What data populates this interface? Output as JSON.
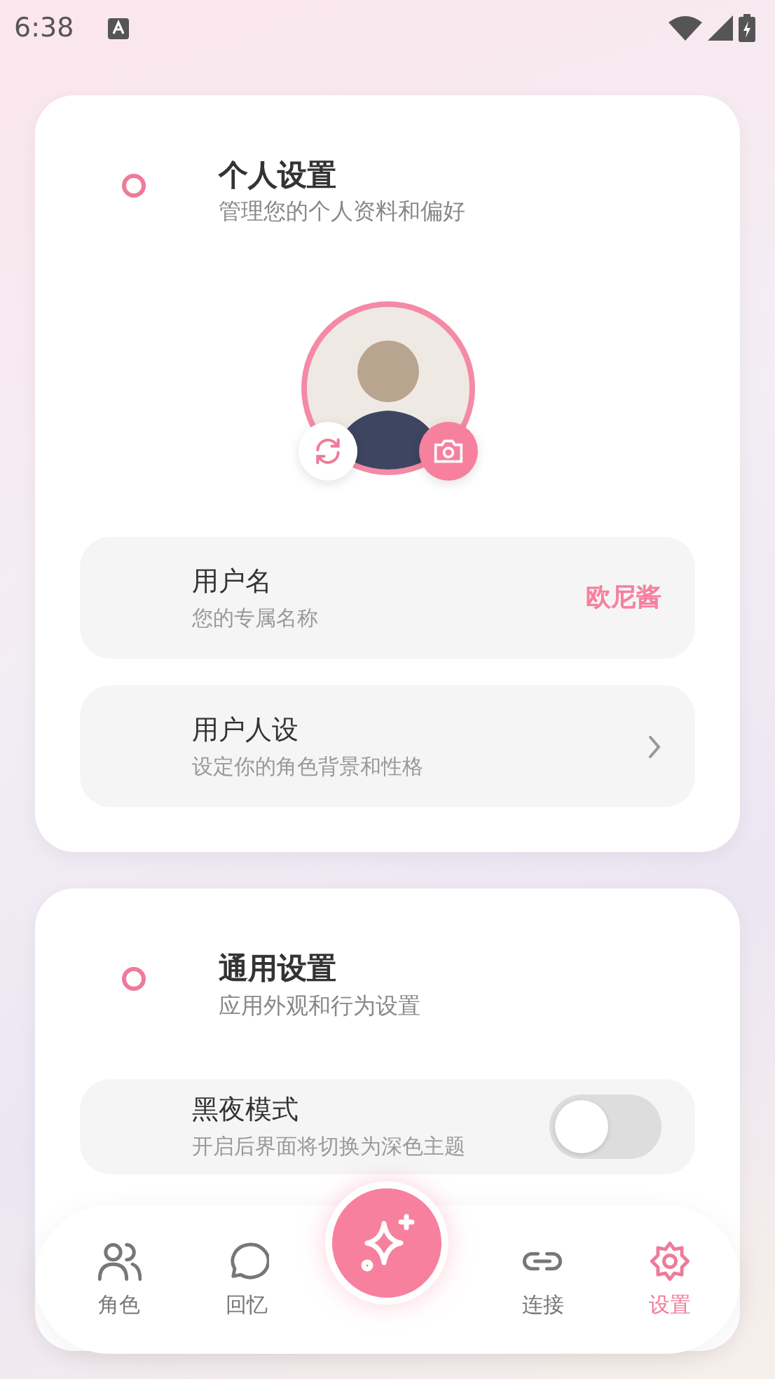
{
  "status_bar": {
    "time": "6:38"
  },
  "personal_settings": {
    "title": "个人设置",
    "subtitle": "管理您的个人资料和偏好",
    "rows": [
      {
        "kind": "value",
        "label": "用户名",
        "description": "您的专属名称",
        "value": "欧尼酱"
      },
      {
        "kind": "link",
        "label": "用户人设",
        "description": "设定你的角色背景和性格"
      }
    ]
  },
  "general_settings": {
    "title": "通用设置",
    "subtitle": "应用外观和行为设置",
    "rows": [
      {
        "kind": "toggle",
        "label": "黑夜模式",
        "description": "开启后界面将切换为深色主题",
        "on": false
      }
    ]
  },
  "bottom_nav": {
    "items": [
      {
        "label": "角色",
        "selected": false
      },
      {
        "label": "回忆",
        "selected": false
      },
      {
        "label": "连接",
        "selected": false
      },
      {
        "label": "设置",
        "selected": true
      }
    ]
  }
}
